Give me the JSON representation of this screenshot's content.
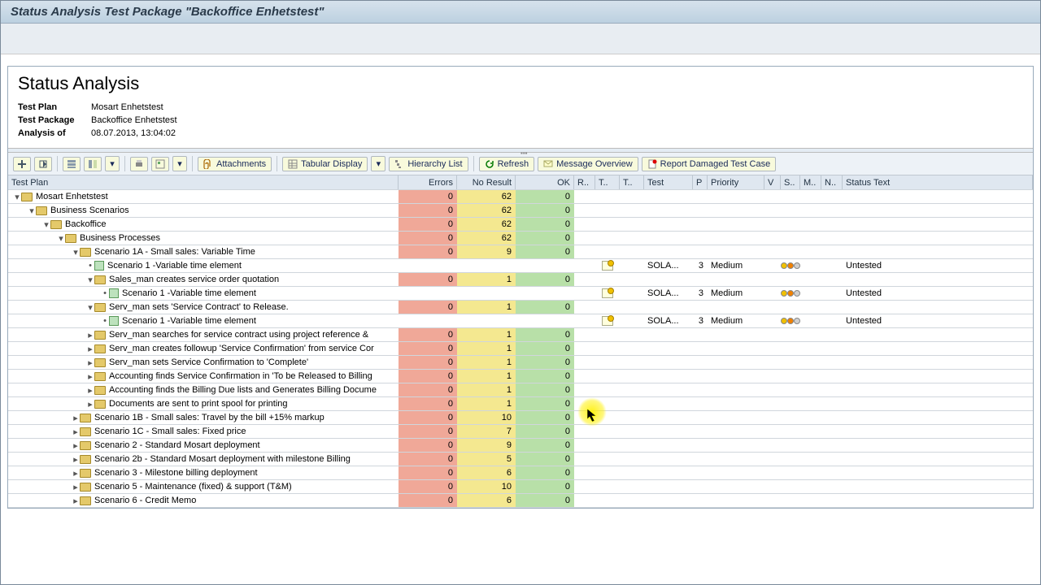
{
  "title": "Status Analysis Test Package \"Backoffice Enhetstest\"",
  "panel_title": "Status Analysis",
  "meta": {
    "test_plan_label": "Test Plan",
    "test_plan": "Mosart Enhetstest",
    "test_package_label": "Test Package",
    "test_package": "Backoffice Enhetstest",
    "analysis_of_label": "Analysis of",
    "analysis_of": "08.07.2013, 13:04:02"
  },
  "toolbar": {
    "attachments": "Attachments",
    "tabular_display": "Tabular Display",
    "hierarchy_list": "Hierarchy List",
    "refresh": "Refresh",
    "message_overview": "Message Overview",
    "report_damaged": "Report Damaged Test Case"
  },
  "columns": {
    "tree": "Test Plan",
    "errors": "Errors",
    "no_result": "No Result",
    "ok": "OK",
    "r": "R..",
    "t1": "T..",
    "t2": "T..",
    "test": "Test",
    "p": "P",
    "priority": "Priority",
    "v": "V",
    "s": "S..",
    "m": "M..",
    "n": "N..",
    "status_text": "Status Text"
  },
  "rows": [
    {
      "indent": 0,
      "expand": "open",
      "kind": "folder",
      "label": "Mosart Enhetstest",
      "errors": "0",
      "no_result": "62",
      "ok": "0"
    },
    {
      "indent": 1,
      "expand": "open",
      "kind": "folder",
      "label": "Business Scenarios",
      "errors": "0",
      "no_result": "62",
      "ok": "0"
    },
    {
      "indent": 2,
      "expand": "open",
      "kind": "folder",
      "label": "Backoffice",
      "errors": "0",
      "no_result": "62",
      "ok": "0"
    },
    {
      "indent": 3,
      "expand": "open",
      "kind": "folder",
      "label": "Business Processes",
      "errors": "0",
      "no_result": "62",
      "ok": "0"
    },
    {
      "indent": 4,
      "expand": "open",
      "kind": "folder",
      "label": "Scenario 1A - Small sales: Variable Time",
      "errors": "0",
      "no_result": "9",
      "ok": "0"
    },
    {
      "indent": 5,
      "expand": "leaf",
      "kind": "doc",
      "label": "Scenario 1 -Variable time element",
      "t1": "icon",
      "test": "SOLA...",
      "p": "3",
      "priority": "Medium",
      "s": "traffic",
      "status_text": "Untested"
    },
    {
      "indent": 5,
      "expand": "open",
      "kind": "folder",
      "label": "Sales_man creates service order quotation",
      "errors": "0",
      "no_result": "1",
      "ok": "0"
    },
    {
      "indent": 6,
      "expand": "leaf",
      "kind": "doc",
      "label": "Scenario 1 -Variable time element",
      "t1": "icon",
      "test": "SOLA...",
      "p": "3",
      "priority": "Medium",
      "s": "traffic",
      "status_text": "Untested"
    },
    {
      "indent": 5,
      "expand": "open",
      "kind": "folder",
      "label": "Serv_man sets 'Service Contract' to Release.",
      "errors": "0",
      "no_result": "1",
      "ok": "0"
    },
    {
      "indent": 6,
      "expand": "leaf",
      "kind": "doc",
      "label": "Scenario 1 -Variable time element",
      "t1": "icon",
      "test": "SOLA...",
      "p": "3",
      "priority": "Medium",
      "s": "traffic",
      "status_text": "Untested"
    },
    {
      "indent": 5,
      "expand": "closed",
      "kind": "folder",
      "label": "Serv_man searches for service contract using project reference &",
      "errors": "0",
      "no_result": "1",
      "ok": "0"
    },
    {
      "indent": 5,
      "expand": "closed",
      "kind": "folder",
      "label": "Serv_man creates followup 'Service Confirmation' from service Cor",
      "errors": "0",
      "no_result": "1",
      "ok": "0"
    },
    {
      "indent": 5,
      "expand": "closed",
      "kind": "folder",
      "label": "Serv_man sets Service Confirmation to 'Complete'",
      "errors": "0",
      "no_result": "1",
      "ok": "0"
    },
    {
      "indent": 5,
      "expand": "closed",
      "kind": "folder",
      "label": "Accounting finds Service Confirmation in 'To be Released to Billing",
      "errors": "0",
      "no_result": "1",
      "ok": "0"
    },
    {
      "indent": 5,
      "expand": "closed",
      "kind": "folder",
      "label": "Accounting finds the Billing Due lists and Generates Billing Docume",
      "errors": "0",
      "no_result": "1",
      "ok": "0"
    },
    {
      "indent": 5,
      "expand": "closed",
      "kind": "folder",
      "label": "Documents are sent to print spool for printing",
      "errors": "0",
      "no_result": "1",
      "ok": "0"
    },
    {
      "indent": 4,
      "expand": "closed",
      "kind": "folder",
      "label": "Scenario 1B - Small sales: Travel by the bill +15% markup",
      "errors": "0",
      "no_result": "10",
      "ok": "0"
    },
    {
      "indent": 4,
      "expand": "closed",
      "kind": "folder",
      "label": "Scenario 1C - Small sales: Fixed price",
      "errors": "0",
      "no_result": "7",
      "ok": "0"
    },
    {
      "indent": 4,
      "expand": "closed",
      "kind": "folder",
      "label": "Scenario 2 - Standard Mosart deployment",
      "errors": "0",
      "no_result": "9",
      "ok": "0"
    },
    {
      "indent": 4,
      "expand": "closed",
      "kind": "folder",
      "label": "Scenario 2b - Standard Mosart deployment with milestone Billing",
      "errors": "0",
      "no_result": "5",
      "ok": "0"
    },
    {
      "indent": 4,
      "expand": "closed",
      "kind": "folder",
      "label": "Scenario 3 - Milestone billing deployment",
      "errors": "0",
      "no_result": "6",
      "ok": "0"
    },
    {
      "indent": 4,
      "expand": "closed",
      "kind": "folder",
      "label": "Scenario 5 - Maintenance (fixed) & support (T&M)",
      "errors": "0",
      "no_result": "10",
      "ok": "0"
    },
    {
      "indent": 4,
      "expand": "closed",
      "kind": "folder",
      "label": "Scenario 6 - Credit Memo",
      "errors": "0",
      "no_result": "6",
      "ok": "0"
    }
  ]
}
